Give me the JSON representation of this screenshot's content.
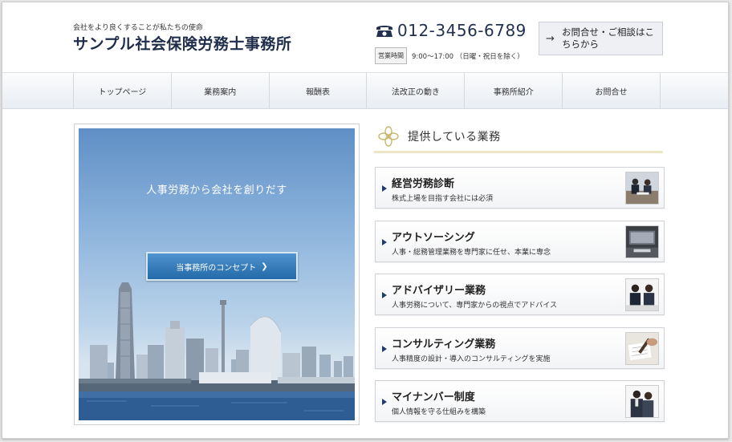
{
  "header": {
    "tagline": "会社をより良くすることが私たちの使命",
    "site_title": "サンプル社会保険労務士事務所",
    "phone": "012-3456-6789",
    "hours_badge": "営業時間",
    "hours_text": "9:00〜17:00 （日曜・祝日を除く）",
    "contact_button": "お問合せ・ご相談はこちらから"
  },
  "nav": {
    "items": [
      "トップページ",
      "業務案内",
      "報酬表",
      "法改正の動き",
      "事務所紹介",
      "お問合せ"
    ]
  },
  "hero": {
    "headline": "人事労務から会社を創りだす",
    "button_label": "当事務所のコンセプト"
  },
  "services": {
    "heading": "提供している業務",
    "items": [
      {
        "title": "経営労務診断",
        "desc": "株式上場を目指す会社には必須",
        "thumb": "meeting-photo"
      },
      {
        "title": "アウトソーシング",
        "desc": "人事・総務管理業務を専門家に任せ、本業に専念",
        "thumb": "office-photo"
      },
      {
        "title": "アドバイザリー業務",
        "desc": "人事労務について、専門家からの視点でアドバイス",
        "thumb": "consultation-photo"
      },
      {
        "title": "コンサルティング業務",
        "desc": "人事精度の設計・導入のコンサルティングを実施",
        "thumb": "writing-photo"
      },
      {
        "title": "マイナンバー制度",
        "desc": "個人情報を守る仕組みを構築",
        "thumb": "business-people-photo"
      }
    ]
  },
  "colors": {
    "navy": "#1f2d4a",
    "hero_button": "#2f78b8",
    "heading_underline": "#ece5c6"
  }
}
